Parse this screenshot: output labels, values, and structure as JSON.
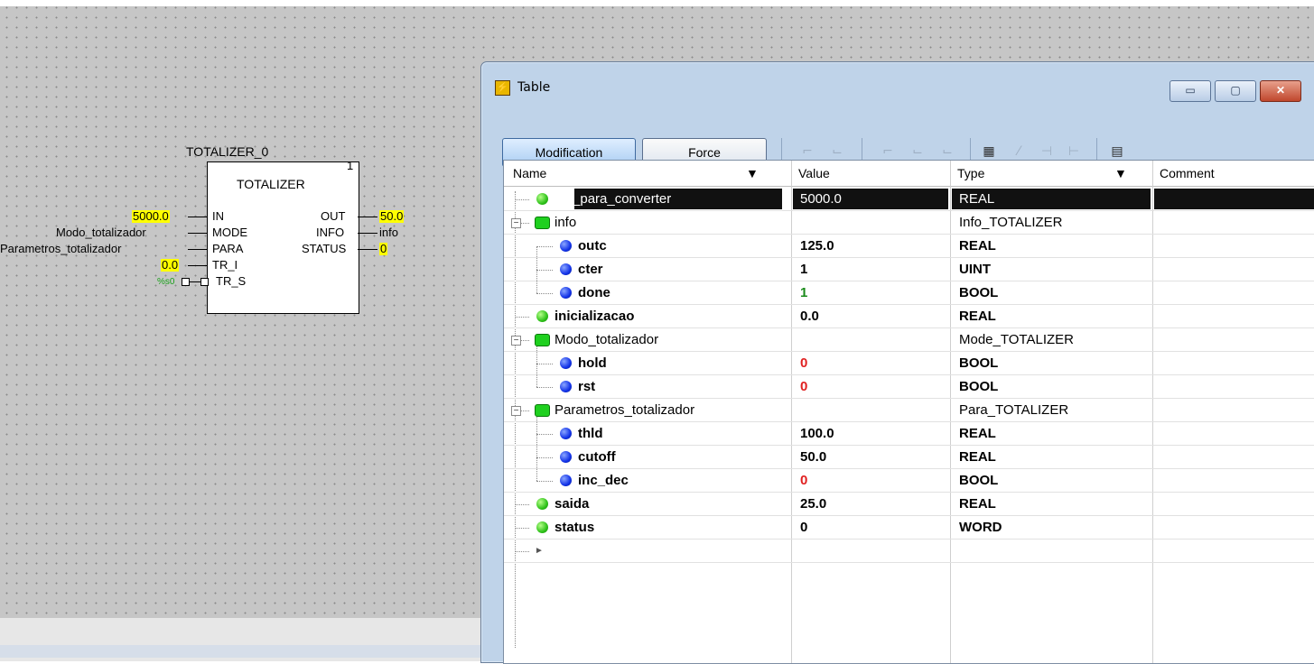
{
  "fbd": {
    "instance": "TOTALIZER_0",
    "type": "TOTALIZER",
    "block_number": "1",
    "inputs": [
      "IN",
      "MODE",
      "PARA",
      "TR_I",
      "TR_S"
    ],
    "outputs": [
      "OUT",
      "INFO",
      "STATUS"
    ],
    "in_values": {
      "IN": "5000.0",
      "MODE": "Modo_totalizador",
      "PARA": "Parametros_totalizador",
      "TR_I": "0.0",
      "TR_S": "%s0"
    },
    "out_values": {
      "OUT": "50.0",
      "INFO": "info",
      "STATUS": "0"
    }
  },
  "window": {
    "title": "Table",
    "minimize": "▭",
    "maximize": "▢",
    "close": "✕"
  },
  "toolbar": {
    "modification": "Modification",
    "force": "Force"
  },
  "columns": {
    "name": "Name",
    "value": "Value",
    "type": "Type",
    "comment": "Comment"
  },
  "rows": [
    {
      "level": 0,
      "icon": "green-dot",
      "name": "EA_para_converter",
      "value": "5000.0",
      "type": "REAL",
      "bold": false,
      "selected": true
    },
    {
      "level": 0,
      "icon": "folder",
      "expander": "−",
      "name": "info",
      "value": "",
      "type": "Info_TOTALIZER",
      "bold": false
    },
    {
      "level": 1,
      "icon": "blue-dot",
      "name": "outc",
      "value": "125.0",
      "type": "REAL",
      "bold": true
    },
    {
      "level": 1,
      "icon": "blue-dot",
      "name": "cter",
      "value": "1",
      "type": "UINT",
      "bold": true
    },
    {
      "level": 1,
      "icon": "blue-dot",
      "name": "done",
      "value": "1",
      "type": "BOOL",
      "bold": true,
      "value_color": "#1a8a1a"
    },
    {
      "level": 0,
      "icon": "green-dot",
      "name": "inicializacao",
      "value": "0.0",
      "type": "REAL",
      "bold": true
    },
    {
      "level": 0,
      "icon": "folder",
      "expander": "−",
      "name": "Modo_totalizador",
      "value": "",
      "type": "Mode_TOTALIZER",
      "bold": false
    },
    {
      "level": 1,
      "icon": "blue-dot",
      "name": "hold",
      "value": "0",
      "type": "BOOL",
      "bold": true,
      "value_color": "#e02020"
    },
    {
      "level": 1,
      "icon": "blue-dot",
      "name": "rst",
      "value": "0",
      "type": "BOOL",
      "bold": true,
      "value_color": "#e02020"
    },
    {
      "level": 0,
      "icon": "folder",
      "expander": "−",
      "name": "Parametros_totalizador",
      "value": "",
      "type": "Para_TOTALIZER",
      "bold": false
    },
    {
      "level": 1,
      "icon": "blue-dot",
      "name": "thld",
      "value": "100.0",
      "type": "REAL",
      "bold": true
    },
    {
      "level": 1,
      "icon": "blue-dot",
      "name": "cutoff",
      "value": "50.0",
      "type": "REAL",
      "bold": true
    },
    {
      "level": 1,
      "icon": "blue-dot",
      "name": "inc_dec",
      "value": "0",
      "type": "BOOL",
      "bold": true,
      "value_color": "#e02020"
    },
    {
      "level": 0,
      "icon": "green-dot",
      "name": "saida",
      "value": "25.0",
      "type": "REAL",
      "bold": true
    },
    {
      "level": 0,
      "icon": "green-dot",
      "name": "status",
      "value": "0",
      "type": "WORD",
      "bold": true
    },
    {
      "level": 0,
      "icon": "new-row-arrow",
      "name": "",
      "value": "",
      "type": "",
      "bold": false
    }
  ]
}
